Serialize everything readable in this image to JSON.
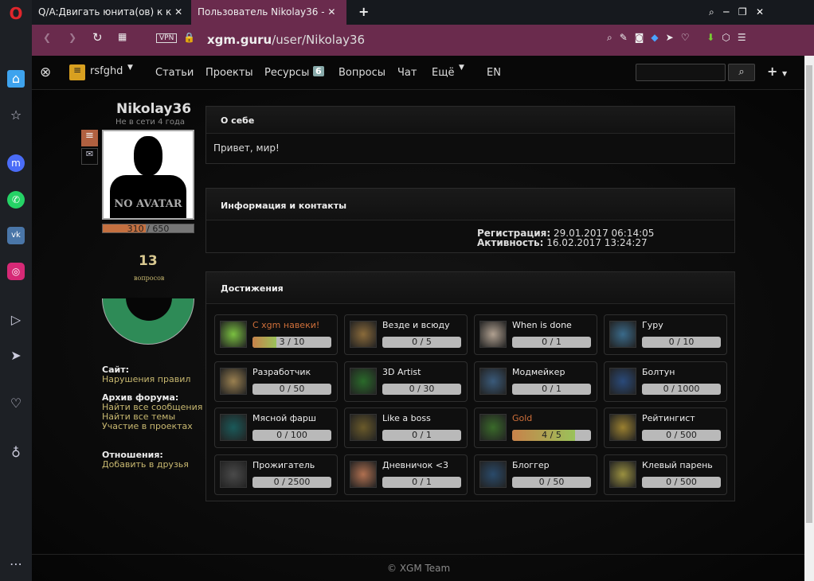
{
  "browser": {
    "tabs": [
      {
        "title": "Q/A:Двигать юнита(ов) к к"
      },
      {
        "title": "Пользователь Nikolay36 -"
      }
    ],
    "vpn": "VPN",
    "url_host": "xgm.guru",
    "url_path": "/user/Nikolay36"
  },
  "nav": {
    "user": "rsfghd",
    "items": [
      "Статьи",
      "Проекты",
      "Ресурсы",
      "Вопросы",
      "Чат",
      "Ещё",
      "EN"
    ],
    "resources_badge": "6"
  },
  "profile": {
    "name": "Nikolay36",
    "status": "Не в сети 4 года",
    "avatar_text": "NO AVATAR",
    "xp": "310 / 650",
    "xp_fraction": 0.477,
    "questions_count": "13",
    "questions_label": "вопросов",
    "site_label": "Сайт:",
    "site_links": [
      "Нарушения правил"
    ],
    "archive_label": "Архив форума:",
    "archive_links": [
      "Найти все сообщения",
      "Найти все темы",
      "Участие в проектах"
    ],
    "relations_label": "Отношения:",
    "relations_links": [
      "Добавить в друзья"
    ]
  },
  "about": {
    "title": "О себе",
    "text": "Привет, мир!"
  },
  "info": {
    "title": "Информация и контакты",
    "reg_label": "Регистрация:",
    "reg_value": "29.01.2017 06:14:05",
    "act_label": "Активность:",
    "act_value": "16.02.2017 13:24:27"
  },
  "achievements": {
    "title": "Достижения",
    "items": [
      {
        "name": "С xgm навеки!",
        "progress": "3 / 10",
        "fraction": 0.3,
        "highlight": true,
        "color": "#7ac040"
      },
      {
        "name": "Везде и всюду",
        "progress": "0 / 5",
        "fraction": 0,
        "color": "#8a6a3a"
      },
      {
        "name": "When is done",
        "progress": "0 / 1",
        "fraction": 0,
        "color": "#b0a090"
      },
      {
        "name": "Гуру",
        "progress": "0 / 10",
        "fraction": 0,
        "color": "#3a6a8a"
      },
      {
        "name": "Разработчик",
        "progress": "0 / 50",
        "fraction": 0,
        "color": "#9a8050"
      },
      {
        "name": "3D Artist",
        "progress": "0 / 30",
        "fraction": 0,
        "color": "#2a6a2a"
      },
      {
        "name": "Модмейкер",
        "progress": "0 / 1",
        "fraction": 0,
        "color": "#3a5a7a"
      },
      {
        "name": "Болтун",
        "progress": "0 / 1000",
        "fraction": 0,
        "color": "#2a4a7a"
      },
      {
        "name": "Мясной фарш",
        "progress": "0 / 100",
        "fraction": 0,
        "color": "#1a5a5a"
      },
      {
        "name": "Like a boss",
        "progress": "0 / 1",
        "fraction": 0,
        "color": "#6a5a2a"
      },
      {
        "name": "Gold",
        "progress": "4 / 5",
        "fraction": 0.8,
        "highlight": true,
        "color": "#3a6a2a"
      },
      {
        "name": "Рейтингист",
        "progress": "0 / 500",
        "fraction": 0,
        "color": "#9a8030"
      },
      {
        "name": "Прожигатель",
        "progress": "0 / 2500",
        "fraction": 0,
        "color": "#4a4a4a"
      },
      {
        "name": "Дневничок <3",
        "progress": "0 / 1",
        "fraction": 0,
        "color": "#b07050"
      },
      {
        "name": "Блоггер",
        "progress": "0 / 50",
        "fraction": 0,
        "color": "#2a4a6a"
      },
      {
        "name": "Клевый парень",
        "progress": "0 / 500",
        "fraction": 0,
        "color": "#9a9040"
      }
    ]
  },
  "footer": "© XGM Team"
}
